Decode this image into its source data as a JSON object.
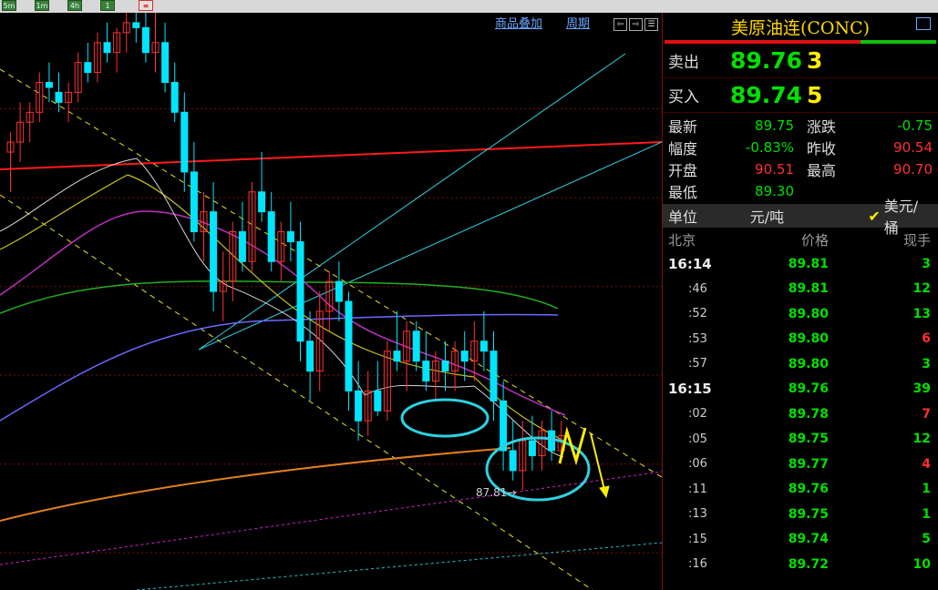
{
  "toolbar_buttons": [
    {
      "icon": "chart-period-icon",
      "label": "5m"
    },
    {
      "icon": "chart-period-icon",
      "label": "1m"
    },
    {
      "icon": "chart-period-icon",
      "label": "4h"
    },
    {
      "icon": "chart-period-icon",
      "label": "1"
    },
    {
      "icon": "draw-tool-icon",
      "label": "≡"
    }
  ],
  "chart_toolbar": {
    "overlay_label": "商品叠加",
    "period_label": "周期"
  },
  "chart_annotation": {
    "low_label": "87.81→"
  },
  "chart_data": {
    "type": "candlestick",
    "ylim": [
      86.2,
      92.0
    ],
    "candles": [
      {
        "o": 90.6,
        "h": 90.8,
        "l": 90.2,
        "c": 90.7
      },
      {
        "o": 90.7,
        "h": 91.1,
        "l": 90.5,
        "c": 90.9
      },
      {
        "o": 90.9,
        "h": 91.1,
        "l": 90.7,
        "c": 91.0
      },
      {
        "o": 91.0,
        "h": 91.4,
        "l": 90.9,
        "c": 91.3
      },
      {
        "o": 91.3,
        "h": 91.5,
        "l": 91.1,
        "c": 91.25
      },
      {
        "o": 91.2,
        "h": 91.4,
        "l": 91.0,
        "c": 91.1
      },
      {
        "o": 91.1,
        "h": 91.3,
        "l": 90.9,
        "c": 91.2
      },
      {
        "o": 91.2,
        "h": 91.6,
        "l": 91.1,
        "c": 91.5
      },
      {
        "o": 91.5,
        "h": 91.7,
        "l": 91.3,
        "c": 91.4
      },
      {
        "o": 91.4,
        "h": 91.8,
        "l": 91.3,
        "c": 91.7
      },
      {
        "o": 91.7,
        "h": 91.9,
        "l": 91.5,
        "c": 91.6
      },
      {
        "o": 91.6,
        "h": 91.85,
        "l": 91.4,
        "c": 91.8
      },
      {
        "o": 91.8,
        "h": 92.0,
        "l": 91.6,
        "c": 91.9
      },
      {
        "o": 91.9,
        "h": 92.05,
        "l": 91.7,
        "c": 91.85
      },
      {
        "o": 91.85,
        "h": 92.1,
        "l": 91.5,
        "c": 91.6
      },
      {
        "o": 91.6,
        "h": 92.1,
        "l": 91.4,
        "c": 91.7
      },
      {
        "o": 91.7,
        "h": 91.9,
        "l": 91.2,
        "c": 91.3
      },
      {
        "o": 91.3,
        "h": 91.5,
        "l": 90.9,
        "c": 91.0
      },
      {
        "o": 91.0,
        "h": 91.2,
        "l": 90.2,
        "c": 90.4
      },
      {
        "o": 90.4,
        "h": 90.7,
        "l": 89.7,
        "c": 89.8
      },
      {
        "o": 89.8,
        "h": 90.2,
        "l": 89.5,
        "c": 90.0
      },
      {
        "o": 90.0,
        "h": 90.3,
        "l": 89.0,
        "c": 89.2
      },
      {
        "o": 89.2,
        "h": 89.6,
        "l": 88.9,
        "c": 89.3
      },
      {
        "o": 89.3,
        "h": 89.9,
        "l": 89.1,
        "c": 89.8
      },
      {
        "o": 89.8,
        "h": 90.1,
        "l": 89.4,
        "c": 89.5
      },
      {
        "o": 89.5,
        "h": 90.3,
        "l": 89.4,
        "c": 90.2
      },
      {
        "o": 90.2,
        "h": 90.6,
        "l": 89.9,
        "c": 90.0
      },
      {
        "o": 90.0,
        "h": 90.2,
        "l": 89.4,
        "c": 89.5
      },
      {
        "o": 89.5,
        "h": 89.9,
        "l": 89.3,
        "c": 89.8
      },
      {
        "o": 89.8,
        "h": 90.1,
        "l": 89.5,
        "c": 89.7
      },
      {
        "o": 89.7,
        "h": 89.9,
        "l": 88.5,
        "c": 88.7
      },
      {
        "o": 88.7,
        "h": 89.0,
        "l": 88.1,
        "c": 88.4
      },
      {
        "o": 88.4,
        "h": 89.2,
        "l": 88.2,
        "c": 89.0
      },
      {
        "o": 89.0,
        "h": 89.4,
        "l": 88.8,
        "c": 89.3
      },
      {
        "o": 89.3,
        "h": 89.5,
        "l": 88.9,
        "c": 89.1
      },
      {
        "o": 89.1,
        "h": 89.2,
        "l": 88.0,
        "c": 88.2
      },
      {
        "o": 88.2,
        "h": 88.5,
        "l": 87.7,
        "c": 87.9
      },
      {
        "o": 87.9,
        "h": 88.4,
        "l": 87.75,
        "c": 88.2
      },
      {
        "o": 88.2,
        "h": 88.5,
        "l": 87.95,
        "c": 88.0
      },
      {
        "o": 88.0,
        "h": 88.7,
        "l": 87.9,
        "c": 88.6
      },
      {
        "o": 88.6,
        "h": 89.0,
        "l": 88.4,
        "c": 88.5
      },
      {
        "o": 88.5,
        "h": 88.9,
        "l": 88.2,
        "c": 88.8
      },
      {
        "o": 88.8,
        "h": 88.9,
        "l": 88.4,
        "c": 88.5
      },
      {
        "o": 88.5,
        "h": 88.8,
        "l": 88.2,
        "c": 88.3
      },
      {
        "o": 88.3,
        "h": 88.6,
        "l": 88.1,
        "c": 88.5
      },
      {
        "o": 88.5,
        "h": 88.7,
        "l": 88.2,
        "c": 88.4
      },
      {
        "o": 88.4,
        "h": 88.7,
        "l": 88.2,
        "c": 88.6
      },
      {
        "o": 88.6,
        "h": 88.8,
        "l": 88.3,
        "c": 88.5
      },
      {
        "o": 88.5,
        "h": 88.9,
        "l": 88.3,
        "c": 88.7
      },
      {
        "o": 88.7,
        "h": 89.0,
        "l": 88.4,
        "c": 88.6
      },
      {
        "o": 88.6,
        "h": 88.8,
        "l": 87.9,
        "c": 88.1
      },
      {
        "o": 88.1,
        "h": 88.3,
        "l": 87.4,
        "c": 87.6
      },
      {
        "o": 87.6,
        "h": 87.9,
        "l": 87.3,
        "c": 87.4
      },
      {
        "o": 87.4,
        "h": 87.9,
        "l": 87.2,
        "c": 87.7
      },
      {
        "o": 87.7,
        "h": 87.95,
        "l": 87.4,
        "c": 87.55
      },
      {
        "o": 87.55,
        "h": 87.9,
        "l": 87.4,
        "c": 87.8
      },
      {
        "o": 87.8,
        "h": 88.0,
        "l": 87.5,
        "c": 87.6
      },
      {
        "o": 87.6,
        "h": 87.9,
        "l": 87.5,
        "c": 87.75
      }
    ],
    "colors": {
      "up": "#ff3030",
      "down": "#00e5ff",
      "grid": "#7a0c0c"
    }
  },
  "quote": {
    "title": "美原油连(CONC)",
    "ratio_sell": 0.72,
    "sell": {
      "label": "卖出",
      "price": "89.76",
      "vol": "3"
    },
    "buy": {
      "label": "买入",
      "price": "89.74",
      "vol": "5"
    },
    "stats": [
      {
        "k": "最新",
        "v": "89.75",
        "color": "green",
        "k2": "涨跌",
        "v2": "-0.75",
        "color2": "green"
      },
      {
        "k": "幅度",
        "v": "-0.83%",
        "color": "green",
        "k2": "昨收",
        "v2": "90.54",
        "color2": "red"
      },
      {
        "k": "开盘",
        "v": "90.51",
        "color": "red",
        "k2": "最高",
        "v2": "90.70",
        "color2": "red"
      },
      {
        "k": "最低",
        "v": "89.30",
        "color": "green",
        "k2": "",
        "v2": "",
        "color2": "green"
      }
    ],
    "unit_label": "单位",
    "unit_cny": "元/吨",
    "unit_usd": "美元/桶",
    "columns": {
      "time": "北京",
      "price": "价格",
      "vol": "现手"
    },
    "ticks": [
      {
        "t": "16:14",
        "p": "89.81",
        "v": "3",
        "vc": "green",
        "min": true
      },
      {
        "t": ":46",
        "p": "89.81",
        "v": "12",
        "vc": "green",
        "min": false
      },
      {
        "t": ":52",
        "p": "89.80",
        "v": "13",
        "vc": "green",
        "min": false
      },
      {
        "t": ":53",
        "p": "89.80",
        "v": "6",
        "vc": "red",
        "min": false
      },
      {
        "t": ":57",
        "p": "89.80",
        "v": "3",
        "vc": "green",
        "min": false
      },
      {
        "t": "16:15",
        "p": "89.76",
        "v": "39",
        "vc": "green",
        "min": true
      },
      {
        "t": ":02",
        "p": "89.78",
        "v": "7",
        "vc": "red",
        "min": false
      },
      {
        "t": ":05",
        "p": "89.75",
        "v": "12",
        "vc": "green",
        "min": false
      },
      {
        "t": ":06",
        "p": "89.77",
        "v": "4",
        "vc": "red",
        "min": false
      },
      {
        "t": ":11",
        "p": "89.76",
        "v": "1",
        "vc": "green",
        "min": false
      },
      {
        "t": ":13",
        "p": "89.75",
        "v": "1",
        "vc": "green",
        "min": false
      },
      {
        "t": ":15",
        "p": "89.74",
        "v": "5",
        "vc": "green",
        "min": false
      },
      {
        "t": ":16",
        "p": "89.72",
        "v": "10",
        "vc": "green",
        "min": false
      }
    ]
  }
}
